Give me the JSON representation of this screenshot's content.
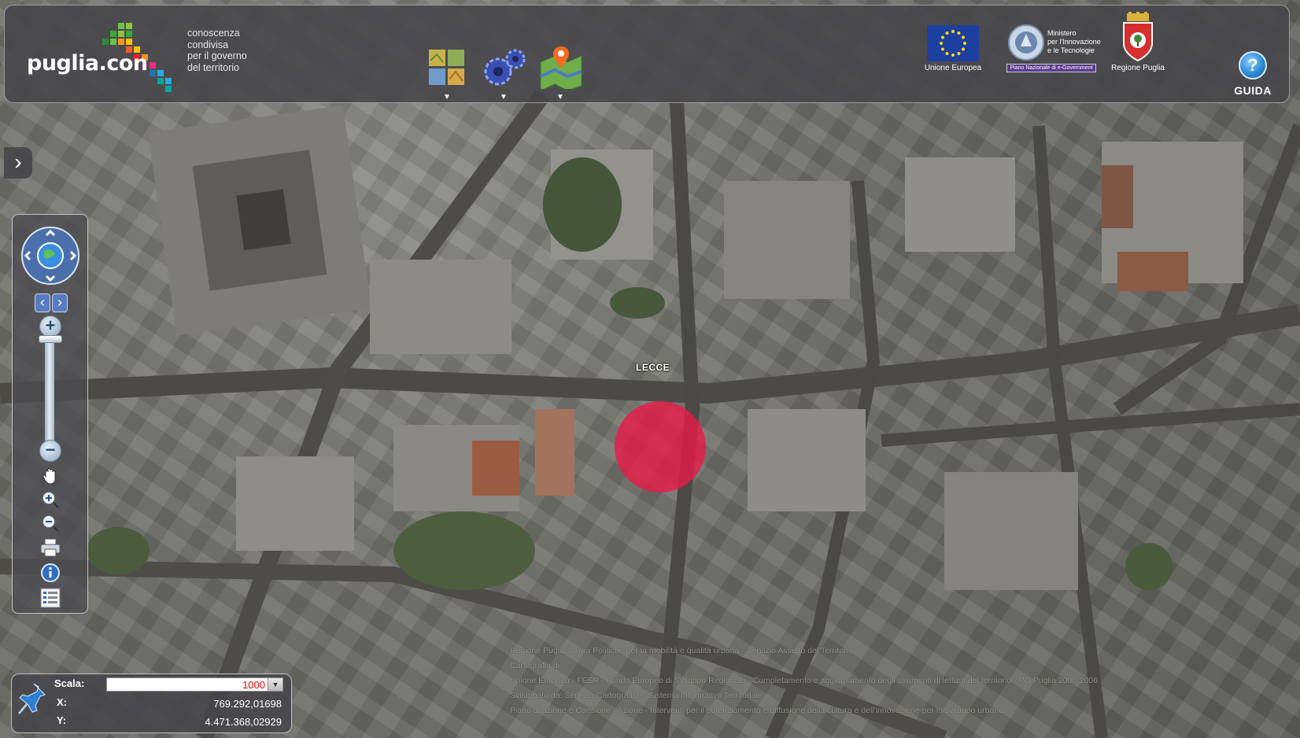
{
  "header": {
    "logo_text": "puglia.con",
    "tagline": [
      "conoscenza",
      "condivisa",
      "per il governo",
      "del territorio"
    ],
    "tools": [
      {
        "name": "layers-icon",
        "caret": "▼"
      },
      {
        "name": "gears-icon",
        "caret": "▼"
      },
      {
        "name": "map-pin-icon",
        "caret": "▼"
      }
    ],
    "partners": {
      "eu": "Unione Europea",
      "ministry_lines": [
        "Ministero",
        "per l'Innovazione",
        "e le Tecnologie"
      ],
      "ministry_sub": "Piano Nazionale di e-Government",
      "region": "Regione Puglia"
    },
    "guide_symbol": "?",
    "guide_label": "GUIDA"
  },
  "panel_toggle": "›",
  "navigation": {
    "pan_icons": [
      "chevron-up",
      "chevron-down",
      "chevron-left",
      "chevron-right"
    ],
    "history_prev": "‹",
    "history_next": "›",
    "zoom_in": "+",
    "zoom_out": "−",
    "zoom_level_fraction": 1.0,
    "tools": [
      "pan-hand-icon",
      "zoom-in-box-icon",
      "zoom-out-box-icon",
      "print-icon",
      "info-icon",
      "legend-icon"
    ]
  },
  "map": {
    "place_label": "LECCE",
    "marker_color": "#ec1846"
  },
  "coordinates": {
    "scale_label": "Scala:",
    "scale_value": "1000",
    "x_label": "X:",
    "x_value": "769.292,01698",
    "y_label": "Y:",
    "y_value": "4.471.368,02929"
  },
  "attribution": [
    "Regione Puglia - Area Politiche per la mobilità e qualità urbana - Servizio Assetto del Territorio",
    "Cartografia di:",
    "Unione Europea - FESR - Fondo Europeo di Sviluppo Regionale - Completamento e aggiornamento degli strumenti di lettura del territorio - PO Puglia 2000-2006",
    "Sviluppato da: Servizio Cartografico - Sistema Informativo Territoriale",
    "Piano di azione e Coesione - Azione - Interventi per il potenziamento e diffusione della cultura e dell'innovazione per lo sviluppo urbano"
  ],
  "colors": {
    "accent": "#2f8bd8",
    "marker": "#ec1846",
    "scale_value": "#ee0000",
    "panel": "#46464a"
  }
}
